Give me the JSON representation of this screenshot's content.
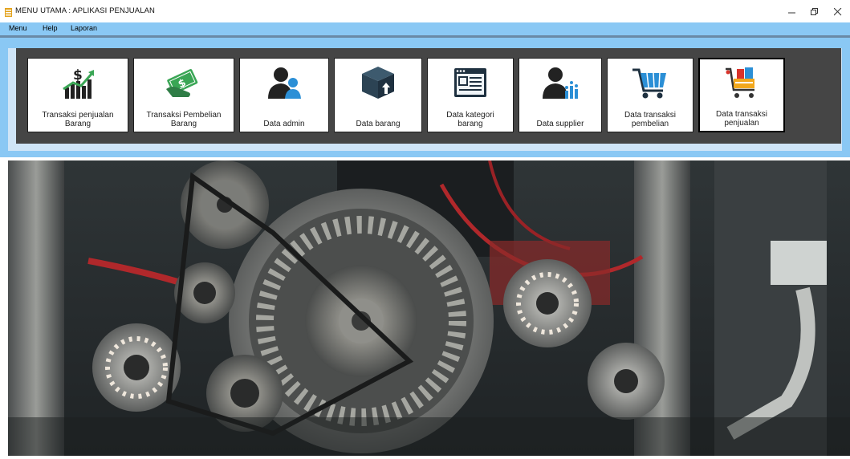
{
  "window": {
    "title": "MENU UTAMA : APLIKASI PENJUALAN"
  },
  "menu": [
    {
      "label": "Menu"
    },
    {
      "label": "Help"
    },
    {
      "label": "Laporan"
    }
  ],
  "tiles": [
    {
      "line1": "Transaksi penjualan",
      "line2": "Barang",
      "icon": "sales-chart-icon"
    },
    {
      "line1": "Transaksi Pembelian",
      "line2": "Barang",
      "icon": "money-hand-icon"
    },
    {
      "line1": "Data admin",
      "line2": "",
      "icon": "admin-users-icon"
    },
    {
      "line1": "Data barang",
      "line2": "",
      "icon": "box-icon"
    },
    {
      "line1": "Data kategori",
      "line2": "barang",
      "icon": "category-list-icon"
    },
    {
      "line1": "Data supplier",
      "line2": "",
      "icon": "supplier-chart-icon"
    },
    {
      "line1": "Data transaksi",
      "line2": "pembelian",
      "icon": "shopping-cart-icon"
    },
    {
      "line1": "Data transaksi",
      "line2": "penjualan",
      "icon": "sales-cart-icon"
    }
  ],
  "colors": {
    "menubar": "#8ac8f4",
    "panel": "#454545",
    "accent": "#2e8b57"
  }
}
